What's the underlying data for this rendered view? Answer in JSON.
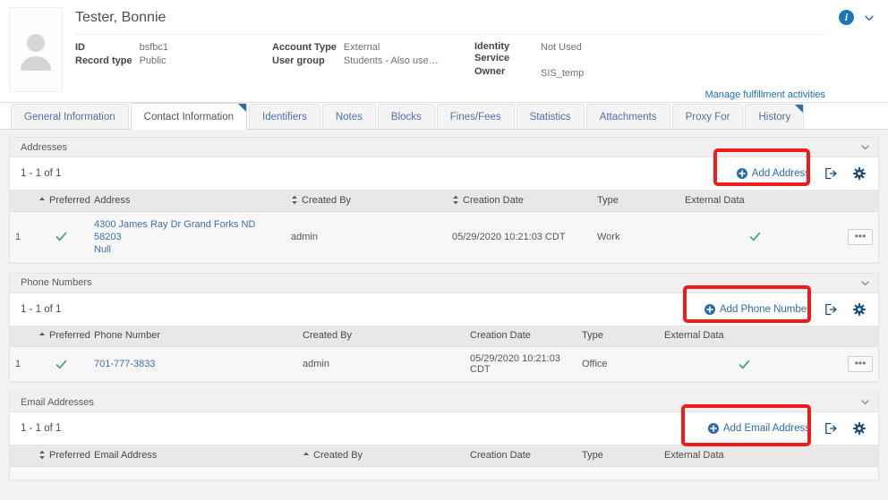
{
  "record": {
    "title": "Tester, Bonnie",
    "avatar_icon": "user-avatar-placeholder",
    "info_icon": "info-icon",
    "collapse_icon": "chevron-down-icon",
    "fields": [
      {
        "label": "ID",
        "value": "bsfbc1"
      },
      {
        "label": "Record type",
        "value": "Public"
      },
      {
        "label": "Account Type",
        "value": "External"
      },
      {
        "label": "User group",
        "value": "Students - Also use…"
      },
      {
        "label": "Identity Service",
        "value": "Not Used"
      },
      {
        "label": "Owner",
        "value": "SIS_temp"
      }
    ],
    "manage_link": "Manage fulfillment activities"
  },
  "tabs": [
    {
      "label": "General Information",
      "active": false,
      "flag": false
    },
    {
      "label": "Contact Information",
      "active": true,
      "flag": true
    },
    {
      "label": "Identifiers",
      "active": false,
      "flag": false
    },
    {
      "label": "Notes",
      "active": false,
      "flag": false
    },
    {
      "label": "Blocks",
      "active": false,
      "flag": false
    },
    {
      "label": "Fines/Fees",
      "active": false,
      "flag": false
    },
    {
      "label": "Statistics",
      "active": false,
      "flag": false
    },
    {
      "label": "Attachments",
      "active": false,
      "flag": false
    },
    {
      "label": "Proxy For",
      "active": false,
      "flag": false
    },
    {
      "label": "History",
      "active": false,
      "flag": true
    }
  ],
  "addresses": {
    "panel_title": "Addresses",
    "count_label": "1 - 1 of 1",
    "add_label": "Add Address",
    "columns": [
      "",
      "Preferred",
      "Address",
      "Created By",
      "Creation Date",
      "Type",
      "External Data",
      ""
    ],
    "sort": {
      "preferred": "asc",
      "created_by": "both",
      "creation_date": "both"
    },
    "rows": [
      {
        "num": "1",
        "preferred": "check-green",
        "address": "4300 James Ray Ray Dr Grand Forks ND 58203 Null",
        "address_line1": "4300 James Ray Dr Grand Forks ND 58203",
        "address_line2": "Null",
        "created_by": "admin",
        "creation_date": "05/29/2020 10:21:03 CDT",
        "type": "Work",
        "external_data": "check-green",
        "actions": "•••"
      }
    ]
  },
  "phones": {
    "panel_title": "Phone Numbers",
    "count_label": "1 - 1 of 1",
    "add_label": "Add Phone Number",
    "columns": [
      "",
      "Preferred",
      "Phone Number",
      "Created By",
      "Creation Date",
      "Type",
      "External Data",
      ""
    ],
    "sort": {
      "preferred": "asc"
    },
    "rows": [
      {
        "num": "1",
        "preferred": "check-green",
        "phone_number": "701-777-3833",
        "created_by": "admin",
        "creation_date": "05/29/2020 10:21:03 CDT",
        "type": "Office",
        "external_data": "check-green",
        "actions": "•••"
      }
    ]
  },
  "emails": {
    "panel_title": "Email Addresses",
    "count_label": "1 - 1 of 1",
    "add_label": "Add Email Address",
    "columns": [
      "",
      "Preferred",
      "Email Address",
      "Created By",
      "Creation Date",
      "Type",
      "External Data",
      ""
    ],
    "sort": {
      "preferred": "both",
      "created_by": "asc"
    },
    "rows": []
  },
  "icons": {
    "export": "export-icon",
    "settings": "gear-icon",
    "add": "plus-circle-icon",
    "collapse": "chevron-down-icon"
  },
  "colors": {
    "link": "#2c6ca6",
    "annotation": "#ee1c1c",
    "check": "#3fa36b",
    "accent": "#1b76b8"
  }
}
